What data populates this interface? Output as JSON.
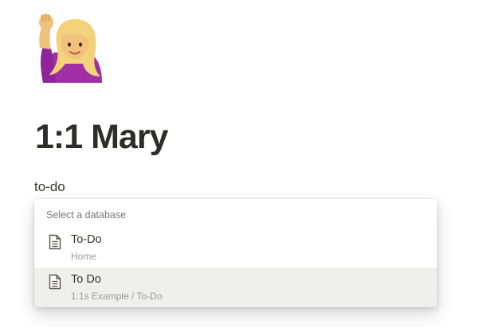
{
  "page": {
    "icon": "person-raising-hand-emoji-icon",
    "title": "1:1 Mary"
  },
  "block": {
    "text": "to-do"
  },
  "database_menu": {
    "header": "Select a database",
    "items": [
      {
        "title": "To-Do",
        "path": "Home",
        "icon": "page-icon",
        "selected": false
      },
      {
        "title": "To Do",
        "path": "1:1s Example / To-Do",
        "icon": "page-icon",
        "selected": true
      }
    ]
  },
  "colors": {
    "title_text": "#2f2d29",
    "body_text": "#37352f",
    "secondary_text": "#9b9a97",
    "selected_row": "#efefee"
  }
}
